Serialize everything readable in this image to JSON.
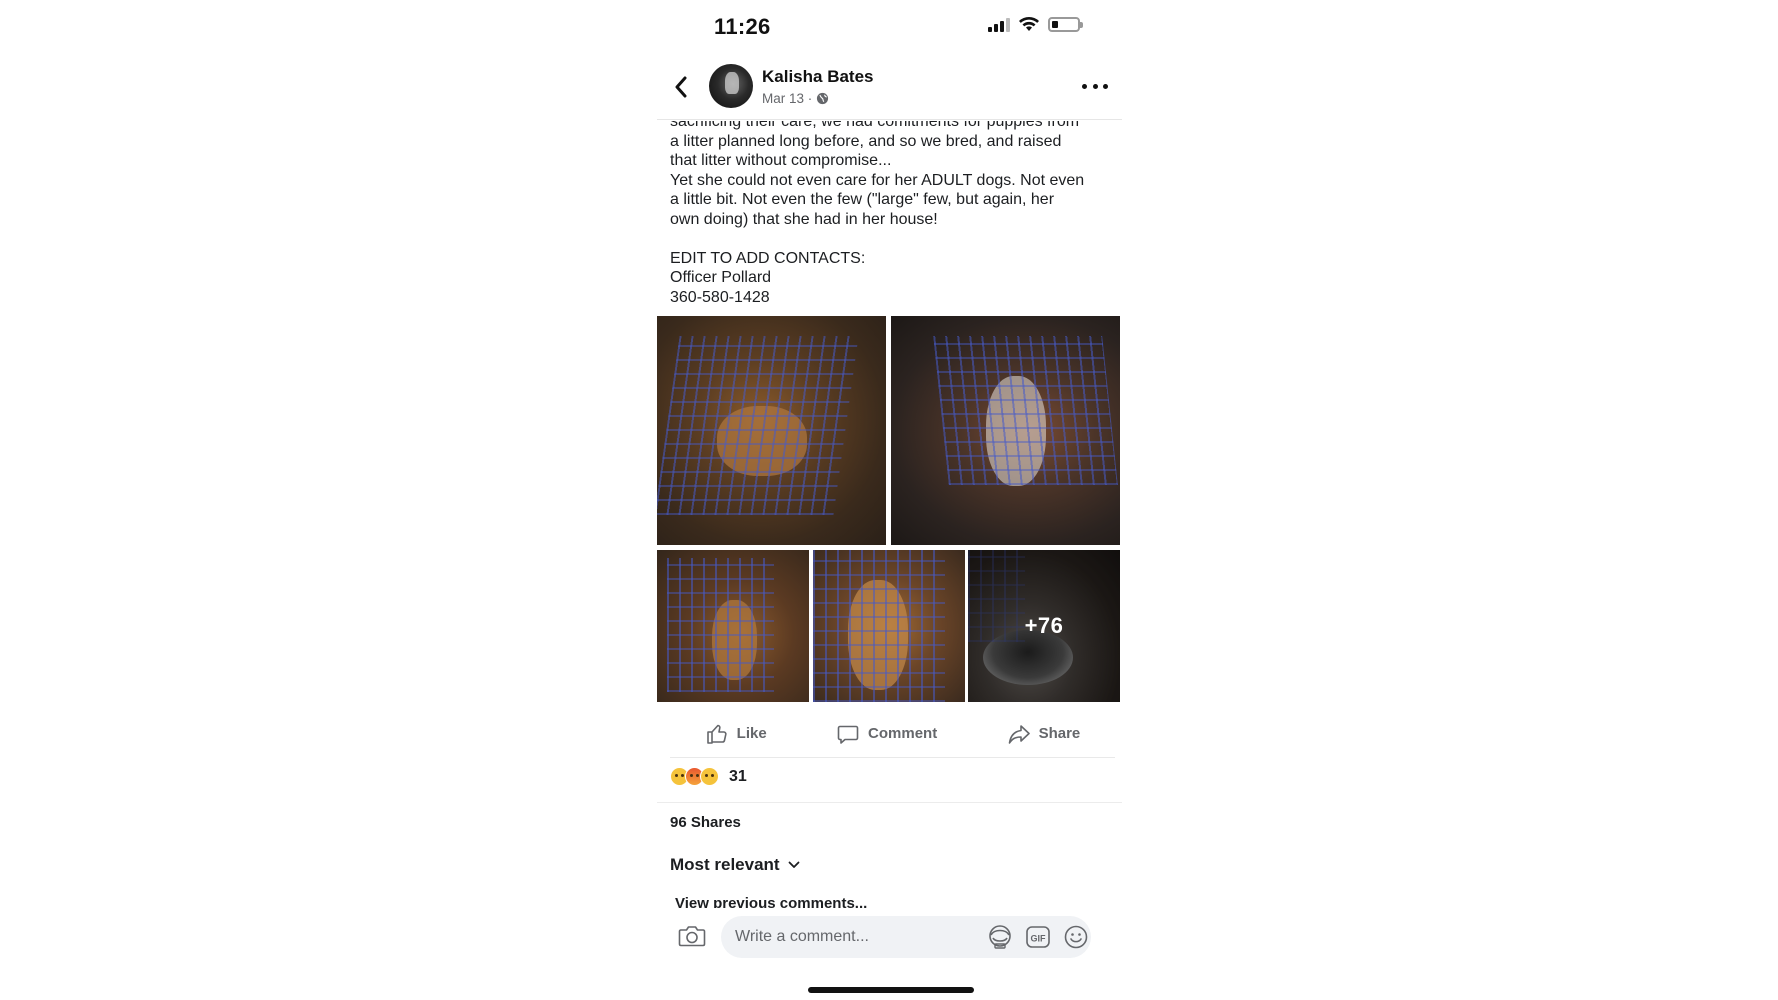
{
  "status_bar": {
    "time": "11:26",
    "signal_icon": "cellular-signal-icon",
    "wifi_icon": "wifi-icon",
    "battery_icon": "battery-icon"
  },
  "header": {
    "author": "Kalisha Bates",
    "date": "Mar 13 ·",
    "privacy_icon": "globe-icon"
  },
  "post": {
    "text": "sacrificing their care, we had comitments for puppies from\na litter planned long before, and so we bred, and raised\nthat litter without compromise...\nYet she could not even care for her ADULT dogs. Not even\na little bit. Not even the few (\"large\" few, but again, her\nown doing) that she had in her house!\n\nEDIT TO ADD CONTACTS:\nOfficer Pollard\n360-580-1428",
    "more_photos_label": "+76"
  },
  "actions": {
    "like": "Like",
    "comment": "Comment",
    "share": "Share"
  },
  "reactions": {
    "count": "31",
    "types": [
      "sad",
      "angry",
      "wow"
    ]
  },
  "shares": "96 Shares",
  "comments": {
    "sort_label": "Most relevant",
    "view_previous": "View previous comments...",
    "input_placeholder": "Write a comment..."
  },
  "colors": {
    "text_primary": "#1c1e21",
    "text_secondary": "#65676b",
    "input_bg": "#f0f2f5"
  }
}
